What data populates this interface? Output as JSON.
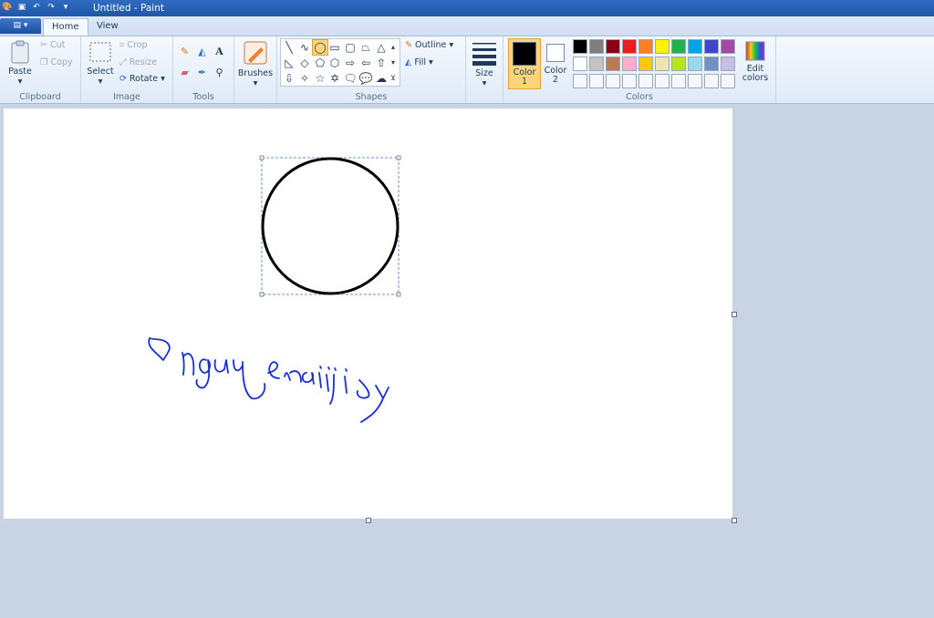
{
  "window": {
    "title": "Untitled - Paint"
  },
  "tabs": [
    {
      "label": "Home"
    },
    {
      "label": "View"
    }
  ],
  "clipboard": {
    "group_label": "Clipboard",
    "paste": "Paste",
    "cut": "Cut",
    "copy": "Copy"
  },
  "image": {
    "group_label": "Image",
    "select": "Select",
    "crop": "Crop",
    "resize": "Resize",
    "rotate": "Rotate"
  },
  "tools": {
    "group_label": "Tools"
  },
  "brushes": {
    "label": "Brushes"
  },
  "shapes": {
    "group_label": "Shapes",
    "outline": "Outline",
    "fill": "Fill"
  },
  "size": {
    "label": "Size"
  },
  "colors": {
    "group_label": "Colors",
    "color1_label": "Color",
    "color1_num": "1",
    "color2_label": "Color",
    "color2_num": "2",
    "edit_label": "Edit",
    "edit_label2": "colors",
    "color1_value": "#000000",
    "color2_value": "#ffffff",
    "palette_row1": [
      "#000000",
      "#7f7f7f",
      "#880015",
      "#ed1c24",
      "#ff7f27",
      "#fff200",
      "#22b14c",
      "#00a2e8",
      "#3f48cc",
      "#a349a4"
    ],
    "palette_row2": [
      "#ffffff",
      "#c3c3c3",
      "#b97a57",
      "#ffaec9",
      "#ffc90e",
      "#efe4b0",
      "#b5e61d",
      "#99d9ea",
      "#7092be",
      "#c8bfe7"
    ]
  },
  "drawing": {
    "circle_stroke": "#000000",
    "ink_color": "#1a2fd0"
  }
}
